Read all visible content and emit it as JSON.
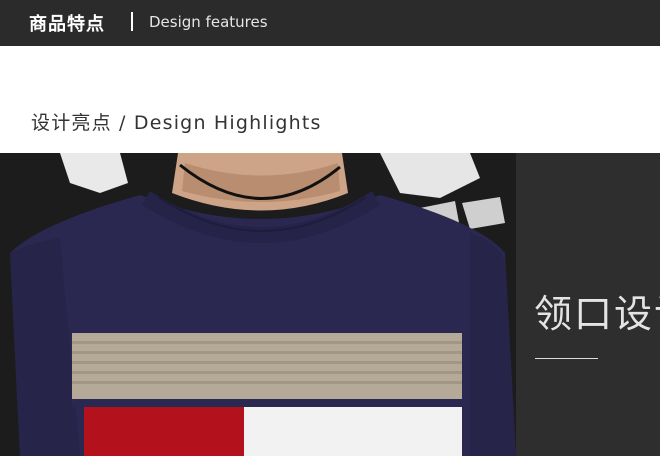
{
  "header": {
    "title_cn": "商品特点",
    "title_en": "Design features"
  },
  "section": {
    "title": "设计亮点 / Design Highlights"
  },
  "feature": {
    "heading": "领口设计"
  },
  "colors": {
    "header_bg": "#2b2b2b",
    "panel_bg": "#2e2e2e",
    "sweater_navy": "#2a2851",
    "stripe_beige": "#b5aa98",
    "block_red": "#b3121c"
  }
}
